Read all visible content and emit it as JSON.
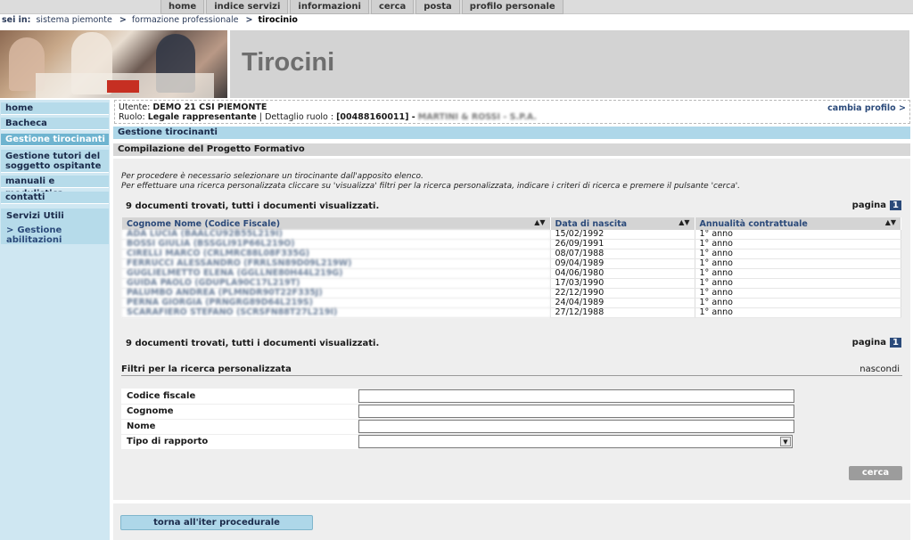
{
  "top_nav": {
    "items": [
      "home",
      "indice servizi",
      "informazioni",
      "cerca",
      "posta",
      "profilo personale"
    ]
  },
  "breadcrumb": {
    "label": "sei in:",
    "items": [
      "sistema piemonte",
      "formazione professionale"
    ],
    "current": "tirocinio"
  },
  "header": {
    "title": "Tirocini"
  },
  "sidebar": {
    "items": [
      "home",
      "Bacheca",
      "Gestione tirocinanti",
      "Gestione tutori del soggetto ospitante",
      "manuali e modulistica",
      "contatti"
    ],
    "active_index": 2,
    "group": {
      "title": "Servizi Utili",
      "sub_item": "Gestione abilitazioni"
    }
  },
  "user": {
    "utente_label": "Utente:",
    "utente_value": "DEMO 21 CSI PIEMONTE",
    "ruolo_label": "Ruolo:",
    "ruolo_value": "Legale rappresentante",
    "dettaglio_label": "Dettaglio ruolo :",
    "dettaglio_value": "[00488160011] -",
    "dettaglio_blurred": "MARTINI & ROSSI - S.P.A.",
    "change_profile": "cambia profilo"
  },
  "sections": {
    "gestione": "Gestione tirocinanti",
    "compilazione": "Compilazione del Progetto Formativo"
  },
  "instructions": {
    "line1": "Per procedere è necessario selezionare un tirocinante dall'apposito elenco.",
    "line2": "Per effettuare una ricerca personalizzata cliccare su 'visualizza' filtri per la ricerca personalizzata, indicare i criteri di ricerca e premere il pulsante 'cerca'."
  },
  "results": {
    "summary": "9 documenti trovati, tutti i documenti visualizzati.",
    "page_label": "pagina",
    "page_number": "1",
    "columns": [
      "Cognome Nome (Codice Fiscale)",
      "Data di nascita",
      "Annualità contrattuale"
    ],
    "rows": [
      [
        "ADA LUCIA (BAALCU92B55L219I)",
        "15/02/1992",
        "1° anno"
      ],
      [
        "BOSSI GIULIA (BSSGLI91P66L219O)",
        "26/09/1991",
        "1° anno"
      ],
      [
        "CIRELLI MARCO (CRLMRC88L08F335G)",
        "08/07/1988",
        "1° anno"
      ],
      [
        "FERRUCCI ALESSANDRO (FRRLSN89D09L219W)",
        "09/04/1989",
        "1° anno"
      ],
      [
        "GUGLIELMETTO ELENA (GGLLNE80H44L219G)",
        "04/06/1980",
        "1° anno"
      ],
      [
        "GUIDA PAOLO (GDUPLA90C17L219T)",
        "17/03/1990",
        "1° anno"
      ],
      [
        "PALUMBO ANDREA (PLMNDR90T22F335J)",
        "22/12/1990",
        "1° anno"
      ],
      [
        "PERNA GIORGIA (PRNGRG89D64L219S)",
        "24/04/1989",
        "1° anno"
      ],
      [
        "SCARAFIERO STEFANO (SCRSFN88T27L219I)",
        "27/12/1988",
        "1° anno"
      ]
    ]
  },
  "filters": {
    "title": "Filtri per la ricerca personalizzata",
    "toggle": "nascondi",
    "fields": [
      "Codice fiscale",
      "Cognome",
      "Nome",
      "Tipo di rapporto"
    ],
    "search_button": "cerca"
  },
  "back_button": "torna all'iter procedurale"
}
